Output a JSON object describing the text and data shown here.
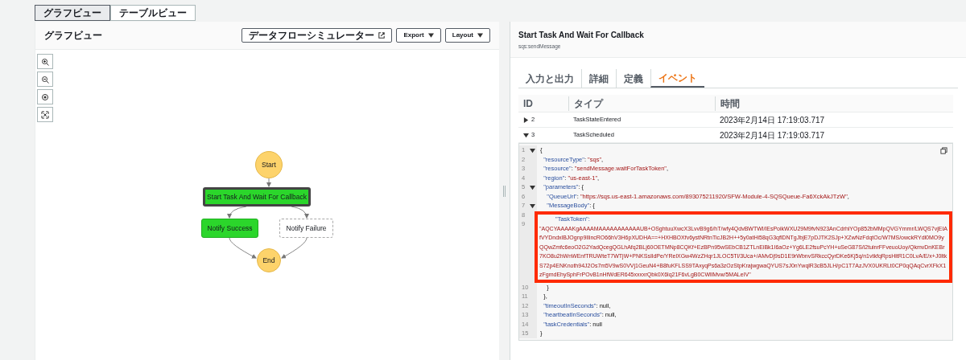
{
  "view_tabs": [
    {
      "label": "グラフビュー",
      "selected": true
    },
    {
      "label": "テーブルビュー",
      "selected": false
    }
  ],
  "graph_panel": {
    "title": "グラフビュー",
    "buttons": [
      {
        "label": "データフローシミュレーター",
        "kind": "external"
      },
      {
        "label": "Export",
        "kind": "dropdown"
      },
      {
        "label": "Layout",
        "kind": "dropdown"
      }
    ],
    "nodes": [
      {
        "kind": "start",
        "label": "Start",
        "succeeded": true,
        "selected": false
      },
      {
        "kind": "task",
        "label": "Start Task And Wait For Callback",
        "succeeded": true,
        "selected": true
      },
      {
        "kind": "success",
        "label": "Notify Success",
        "succeeded": true,
        "selected": false
      },
      {
        "kind": "failure",
        "label": "Notify Failure",
        "succeeded": false,
        "selected": false
      },
      {
        "kind": "end",
        "label": "End",
        "succeeded": true,
        "selected": false
      }
    ]
  },
  "detail_panel": {
    "title": "Start Task And Wait For Callback",
    "subtitle": "sqs:sendMessage",
    "tabs": [
      {
        "label": "入力と出力",
        "selected": false
      },
      {
        "label": "詳細",
        "selected": false
      },
      {
        "label": "定義",
        "selected": false
      },
      {
        "label": "イベント",
        "selected": true
      }
    ],
    "table": {
      "columns": [
        "ID",
        "タイプ",
        "時間"
      ],
      "rows": [
        {
          "id": "2",
          "type": "TaskStateEntered",
          "time": "2023年2月14日 17:19:03.717",
          "expanded": false
        },
        {
          "id": "3",
          "type": "TaskScheduled",
          "time": "2023年2月14日 17:19:03.717",
          "expanded": true
        }
      ]
    },
    "code": [
      {
        "kind": "line",
        "number": "1",
        "fold": true,
        "parts": [
          {
            "kind": "punct",
            "text": "{"
          }
        ]
      },
      {
        "kind": "line",
        "number": "2",
        "fold": false,
        "parts": [
          {
            "kind": "key",
            "text": "  \"resourceType\""
          },
          {
            "kind": "punct",
            "text": ": "
          },
          {
            "kind": "string",
            "text": "\"sqs\""
          },
          {
            "kind": "punct",
            "text": ","
          }
        ]
      },
      {
        "kind": "line",
        "number": "3",
        "fold": false,
        "parts": [
          {
            "kind": "key",
            "text": "  \"resource\""
          },
          {
            "kind": "punct",
            "text": ": "
          },
          {
            "kind": "string",
            "text": "\"sendMessage.waitForTaskToken\""
          },
          {
            "kind": "punct",
            "text": ","
          }
        ]
      },
      {
        "kind": "line",
        "number": "4",
        "fold": false,
        "parts": [
          {
            "kind": "key",
            "text": "  \"region\""
          },
          {
            "kind": "punct",
            "text": ": "
          },
          {
            "kind": "string",
            "text": "\"us-east-1\""
          },
          {
            "kind": "punct",
            "text": ","
          }
        ]
      },
      {
        "kind": "line",
        "number": "5",
        "fold": true,
        "parts": [
          {
            "kind": "key",
            "text": "  \"parameters\""
          },
          {
            "kind": "punct",
            "text": ": {"
          }
        ]
      },
      {
        "kind": "line",
        "number": "6",
        "fold": false,
        "parts": [
          {
            "kind": "key",
            "text": "    \"QueueUrl\""
          },
          {
            "kind": "punct",
            "text": ": "
          },
          {
            "kind": "string",
            "text": "\"https://sqs.us-east-1.amazonaws.com/893075211920/SFW-Module-4-SQSQueue-Fa6XckAkJTzW\""
          },
          {
            "kind": "punct",
            "text": ","
          }
        ]
      },
      {
        "kind": "line",
        "number": "7",
        "fold": true,
        "parts": [
          {
            "kind": "key",
            "text": "    \"MessageBody\""
          },
          {
            "kind": "punct",
            "text": ": {"
          }
        ]
      },
      {
        "kind": "line",
        "number": "8",
        "fold": false
      },
      {
        "kind": "token",
        "number": "9",
        "fold": false,
        "key": "\"TaskToken\":",
        "value": "\"AQCYAAAAKgAAAAMAAAAAAAAAAAUB+OSghtuuXwcX3LvvB9g6/hT/wfy4QdvBWTWl/IEsPoikWXU29M9fvN923AnCdrhiYOp852bMMpQVGYmmr/LWQS7vjEIAfVYDndxlBJOgnp9IlincRO66hV3H6pXUDHA==+HXHBOXfv6ystNRtnTicJB2H++5y0atHi58qG3qflDNTgJbjE7pDJTK2SJp+XZwNzFdqtOc/W7MS/owckRYdl0MO9yQQwZmfc6eoO2G2YadQcegQGLhAfq2BLj60OETMNp8CQKf+EzBPn95wSEbCB1ZTLnEiBk1I6aOz+Yg6LE2fsuPcYH+uSeG87S/i2tuinrFFveuoUoy/QkmvDnKEBr7KO8u2hWnWEnfTRUWteT7WTjW+PNKSsIldPe/YRelXGw4WzZHqr1JLOC5Tl/3Uca+/AMvDj9sD1E9rWbnvSRkccQyrDKe6Kj5q/n1vtkfqRpsHitR1C0LvA/E/x+J0ltkS72p4ENKnoth94J2Os7m5V9wS0VVj1GeuN4+B8fuKFLSS9TAxyqPs6a3zOzStpKrajwgwaQYUS7sJ0nYwqlR3cB5JLH/pC1T7AzJVX0UKRLt0CP0qQAqCvrXFkX1zFgmdEhySphFrPOvB1nHfWdER645xxxxrQbk0X6lq21F6vLgB0CWllMvw/5MALeIV\""
      },
      {
        "kind": "line",
        "number": "10",
        "fold": false,
        "parts": [
          {
            "kind": "punct",
            "text": "    }"
          }
        ]
      },
      {
        "kind": "line",
        "number": "11",
        "fold": false,
        "parts": [
          {
            "kind": "punct",
            "text": "  },"
          }
        ]
      },
      {
        "kind": "line",
        "number": "12",
        "fold": false,
        "parts": [
          {
            "kind": "key",
            "text": "  \"timeoutInSeconds\""
          },
          {
            "kind": "punct",
            "text": ": null,"
          }
        ]
      },
      {
        "kind": "line",
        "number": "13",
        "fold": false,
        "parts": [
          {
            "kind": "key",
            "text": "  \"heartbeatInSeconds\""
          },
          {
            "kind": "punct",
            "text": ": null,"
          }
        ]
      },
      {
        "kind": "line",
        "number": "14",
        "fold": false,
        "parts": [
          {
            "kind": "key",
            "text": "  \"taskCredentials\""
          },
          {
            "kind": "punct",
            "text": ": null"
          }
        ]
      },
      {
        "kind": "line",
        "number": "15",
        "fold": false,
        "parts": [
          {
            "kind": "punct",
            "text": "}"
          }
        ]
      }
    ]
  }
}
